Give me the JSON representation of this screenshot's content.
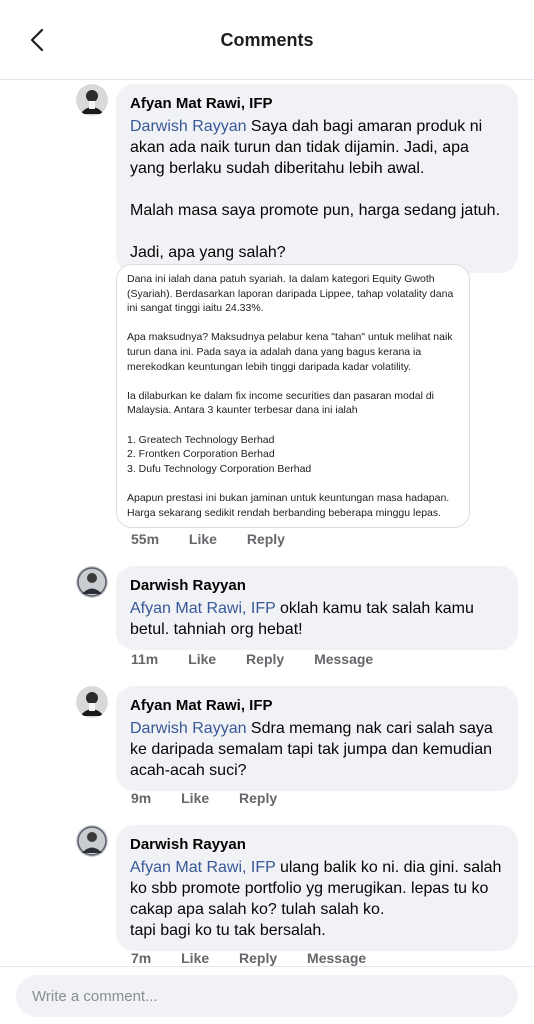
{
  "header": {
    "title": "Comments",
    "back_icon": "chevron-left-icon"
  },
  "comments": [
    {
      "author": "Afyan Mat Rawi, IFP",
      "mention": "Darwish Rayyan",
      "text_1": " Saya dah bagi amaran produk ni akan ada naik turun dan tidak dijamin. Jadi, apa yang berlaku sudah diberitahu lebih awal.",
      "text_2": "Malah masa saya promote pun, harga sedang jatuh.",
      "text_3": "Jadi, apa yang salah?",
      "attachment": {
        "p1": "Dana ini ialah dana patuh syariah. Ia dalam kategori Equity Gwoth (Syariah). Berdasarkan laporan daripada Lippee, tahap volatality dana ini sangat tinggi iaitu 24.33%.",
        "p2": "Apa maksudnya?  Maksudnya pelabur kena \"tahan\" untuk melihat naik turun dana ini. Pada saya ia adalah dana yang bagus kerana ia merekodkan keuntungan lebih tinggi daripada kadar volatility.",
        "p3": "Ia dilaburkan ke dalam fix income securities dan pasaran modal di Malaysia. Antara 3 kaunter terbesar dana ini ialah",
        "list_1": "1. Greatech Technology Berhad",
        "list_2": "2. Frontken Corporation Berhad",
        "list_3": "3. Dufu Technology Corporation Berhad",
        "p4": "Apapun prestasi ini bukan jaminan untuk keuntungan masa hadapan. Harga sekarang sedikit rendah berbanding beberapa minggu lepas."
      },
      "time": "55m",
      "like": "Like",
      "reply": "Reply"
    },
    {
      "author": "Darwish Rayyan",
      "mention": "Afyan Mat Rawi, IFP",
      "text_1": " oklah kamu tak salah kamu betul. tahniah org hebat!",
      "time": "11m",
      "like": "Like",
      "reply": "Reply",
      "message": "Message"
    },
    {
      "author": "Afyan Mat Rawi, IFP",
      "mention": "Darwish Rayyan",
      "text_1": " Sdra memang nak cari salah saya ke daripada semalam tapi tak jumpa dan kemudian acah-acah suci?",
      "time": "9m",
      "like": "Like",
      "reply": "Reply"
    },
    {
      "author": "Darwish Rayyan",
      "mention": "Afyan Mat Rawi, IFP",
      "text_1": " ulang balik ko ni. dia gini. salah ko sbb promote portfolio yg merugikan. lepas tu ko cakap apa salah ko? tulah salah ko.",
      "text_2": "tapi bagi ko tu tak bersalah.",
      "time": "7m",
      "like": "Like",
      "reply": "Reply",
      "message": "Message"
    }
  ],
  "composer": {
    "placeholder": "Write a comment..."
  },
  "colors": {
    "mention": "#385898",
    "bubble": "#f0f2f5",
    "meta": "#65676b"
  }
}
